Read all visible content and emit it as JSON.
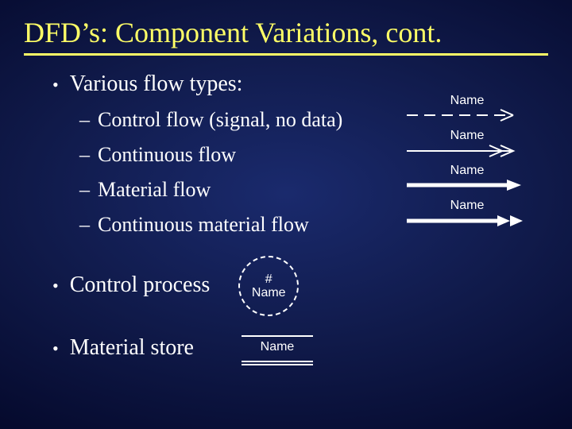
{
  "title": "DFD’s:  Component Variations, cont.",
  "bullets": {
    "flow_types_heading": "Various flow types:",
    "control_process": "Control process",
    "material_store": "Material store"
  },
  "flows": {
    "control": {
      "label": "Control flow (signal, no data)",
      "name": "Name"
    },
    "continuous": {
      "label": "Continuous flow",
      "name": "Name"
    },
    "material": {
      "label": "Material flow",
      "name": "Name"
    },
    "cont_material": {
      "label": "Continuous material flow",
      "name": "Name"
    }
  },
  "process": {
    "line1": "#",
    "line2": "Name"
  },
  "store": {
    "label": "Name"
  }
}
